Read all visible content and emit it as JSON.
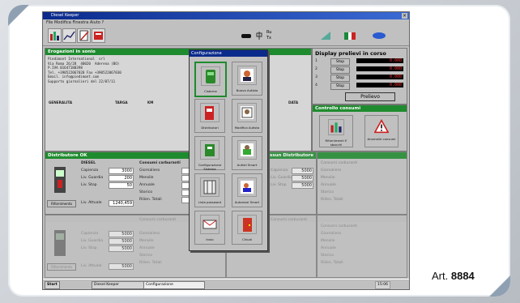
{
  "window": {
    "title": "Diesel Keeper",
    "menu": "File   Modifica   Finestra   Aiuto   ?",
    "toolbar": {
      "lang_flag": "it",
      "indicators": [
        "Ru",
        "Tx"
      ]
    }
  },
  "panels": {
    "info": {
      "header": "Erogazioni in sonio",
      "lines": [
        "Piedimont International  srl",
        "Via Roma 26/28  40020  Aderena (BO)",
        "P.IVA 01647180398",
        "Tel. +390522067020 Fax +390522067030",
        "Email. info@piedimont.com",
        "",
        "Supporto giornalieri del 22/07/11"
      ],
      "columns": [
        "GENERALITA",
        "TARGA",
        "KM",
        "DATA"
      ]
    },
    "display": {
      "header": "Display prelievi in corso",
      "rows": [
        {
          "n": "1",
          "btn": "Stop",
          "val": "0.000"
        },
        {
          "n": "2",
          "btn": "Stop",
          "val": "0.000"
        },
        {
          "n": "3",
          "btn": "Stop",
          "val": "0.000"
        },
        {
          "n": "4",
          "btn": "Stop",
          "val": "0.000"
        }
      ],
      "prelievo": "Prelievo"
    },
    "consumi": {
      "header": "Controllo consumi",
      "btn1": "Rifornimenti E sbocchi",
      "btn2": "Anomalie consumi"
    },
    "distributor1": {
      "header": "Distributore OK",
      "fuel": "DIESEL",
      "consumi_header": "Consumi carburanti",
      "fields": [
        {
          "label": "Capienza",
          "value": "3000"
        },
        {
          "label": "Liv. Guardia",
          "value": "200"
        },
        {
          "label": "Liv. Stop",
          "value": "50"
        }
      ],
      "stats": [
        "Giornaliero",
        "Mensile",
        "Annuale",
        "Storico",
        "Rilien. Totali"
      ],
      "attuale_label": "Liv. Attuale",
      "attuale_value": "1240,459",
      "button": "Rifornimento"
    },
    "distributor2_header": "Nessun Distributore",
    "generic": {
      "fields": [
        {
          "label": "Capienza",
          "value": "5000"
        },
        {
          "label": "Liv. Guardia",
          "value": "5000"
        },
        {
          "label": "Liv. Stop",
          "value": "5000"
        }
      ],
      "stats": [
        "Giornaliero",
        "Mensile",
        "Annuale",
        "Storico",
        "Rilien. Totali"
      ],
      "attuale_label": "Liv. Attuale",
      "attuale_value": "5000",
      "consumi_header": "Consumi carburanti",
      "button": "Rifornimento"
    }
  },
  "dialog": {
    "title": "Configurazione",
    "buttons": [
      {
        "label": "Cisterne",
        "icon": "tank-icon"
      },
      {
        "label": "Nuovo Autista",
        "icon": "new-driver-icon"
      },
      {
        "label": "Distributori",
        "icon": "pump-icon"
      },
      {
        "label": "Modifica Autista",
        "icon": "edit-driver-icon"
      },
      {
        "label": "Configurazione Sistema",
        "icon": "system-config-icon"
      },
      {
        "label": "Autisti Smart",
        "icon": "smart-driver-icon"
      },
      {
        "label": "Lista password",
        "icon": "password-list-icon"
      },
      {
        "label": "Autorezzi Smart",
        "icon": "smart-vehicle-icon"
      },
      {
        "label": "Invio",
        "icon": "send-icon"
      },
      {
        "label": "Chiudi",
        "icon": "exit-door-icon"
      }
    ]
  },
  "taskbar": {
    "start": "Start",
    "items": [
      "Diesel Keeper",
      "Configurazione"
    ],
    "clock": "15:06"
  },
  "caption": {
    "prefix": "Art.",
    "number": "8884"
  },
  "colors": {
    "green_header": "#1e8b2e",
    "title_blue": "#0a2a8c"
  }
}
